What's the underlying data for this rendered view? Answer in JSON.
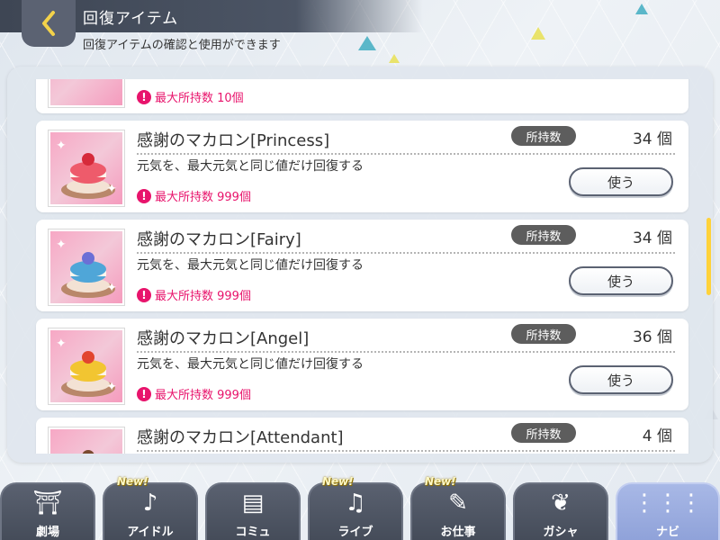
{
  "header": {
    "title": "回復アイテム",
    "subtitle": "回復アイテムの確認と使用ができます"
  },
  "items": [
    {
      "name": "",
      "owned_label": "",
      "quantity": "",
      "description": "",
      "limit": "最大所持数 10個",
      "use_label": "使う",
      "color": "#f48ab4"
    },
    {
      "name": "感謝のマカロン[Princess]",
      "owned_label": "所持数",
      "quantity": "34 個",
      "description": "元気を、最大元気と同じ値だけ回復する",
      "limit": "最大所持数 999個",
      "use_label": "使う",
      "color": "#ee5b6b"
    },
    {
      "name": "感謝のマカロン[Fairy]",
      "owned_label": "所持数",
      "quantity": "34 個",
      "description": "元気を、最大元気と同じ値だけ回復する",
      "limit": "最大所持数 999個",
      "use_label": "使う",
      "color": "#4fa6d8"
    },
    {
      "name": "感謝のマカロン[Angel]",
      "owned_label": "所持数",
      "quantity": "36 個",
      "description": "元気を、最大元気と同じ値だけ回復する",
      "limit": "最大所持数 999個",
      "use_label": "使う",
      "color": "#f2c531"
    },
    {
      "name": "感謝のマカロン[Attendant]",
      "owned_label": "所持数",
      "quantity": "4 個",
      "description": "",
      "limit": "",
      "use_label": "",
      "color": "#55b58a"
    }
  ],
  "nav": {
    "new_badge": "New!",
    "tabs": [
      {
        "label": "劇場",
        "icon": "theater-icon",
        "new": false
      },
      {
        "label": "アイドル",
        "icon": "idol-icon",
        "new": true
      },
      {
        "label": "コミュ",
        "icon": "commu-icon",
        "new": false
      },
      {
        "label": "ライブ",
        "icon": "live-icon",
        "new": true
      },
      {
        "label": "お仕事",
        "icon": "work-icon",
        "new": true
      },
      {
        "label": "ガシャ",
        "icon": "gacha-icon",
        "new": false
      },
      {
        "label": "ナビ",
        "icon": "navi-icon",
        "new": false,
        "active": true
      }
    ]
  }
}
